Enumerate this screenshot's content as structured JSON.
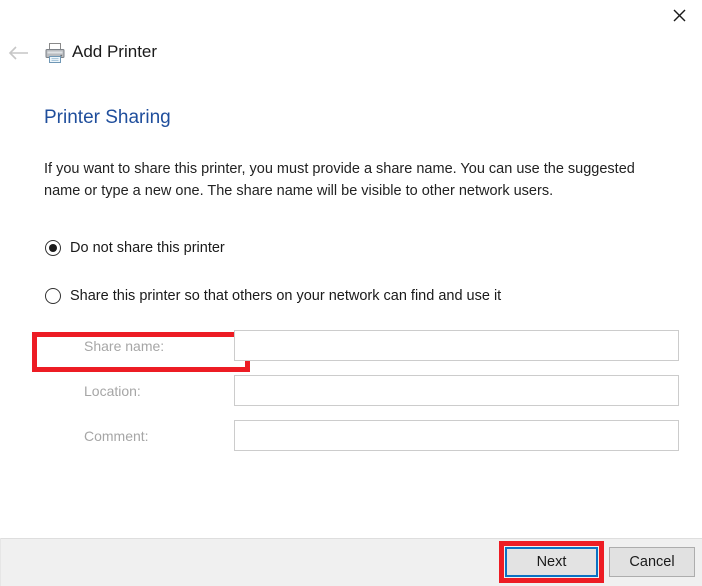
{
  "window": {
    "app_title": "Add Printer",
    "close_label": "✕",
    "back_label": "←",
    "printer_icon_name": "printer-icon"
  },
  "content": {
    "heading": "Printer Sharing",
    "intro": "If you want to share this printer, you must provide a share name. You can use the suggested name or type a new one. The share name will be visible to other network users.",
    "options": [
      {
        "label": "Do not share this printer",
        "selected": true,
        "highlighted": true
      },
      {
        "label": "Share this printer so that others on your network can find and use it",
        "selected": false,
        "highlighted": false
      }
    ],
    "fields": [
      {
        "label": "Share name:",
        "value": "",
        "placeholder": "",
        "disabled": true
      },
      {
        "label": "Location:",
        "value": "",
        "placeholder": "",
        "disabled": true
      },
      {
        "label": "Comment:",
        "value": "",
        "placeholder": "",
        "disabled": true
      }
    ]
  },
  "footer": {
    "next_label": "Next",
    "cancel_label": "Cancel"
  },
  "colors": {
    "heading_blue": "#1f4e9c",
    "annotation_red": "#ed1c24",
    "focus_blue": "#0a72c4",
    "footer_gray": "#f0f0f0",
    "disabled_label_gray": "#a6a6a6"
  }
}
